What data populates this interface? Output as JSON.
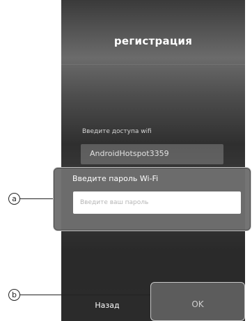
{
  "screen": {
    "title": "регистрация",
    "ssid_label": "Введите доступа wifi",
    "ssid_value": "AndroidHotspot3359"
  },
  "password_dialog": {
    "title": "Введите пароль Wi-Fi",
    "placeholder": "Введите ваш пароль",
    "value": ""
  },
  "bottom_bar": {
    "back_label": "Назад",
    "ok_label": "OK"
  },
  "annotations": {
    "a": "ⓐ",
    "b": "ⓑ"
  },
  "colors": {
    "background_dark": "#2b2b2b",
    "text_light": "#ffffff",
    "input_bg": "#ffffff",
    "callout_border": "#c8c8c8"
  }
}
